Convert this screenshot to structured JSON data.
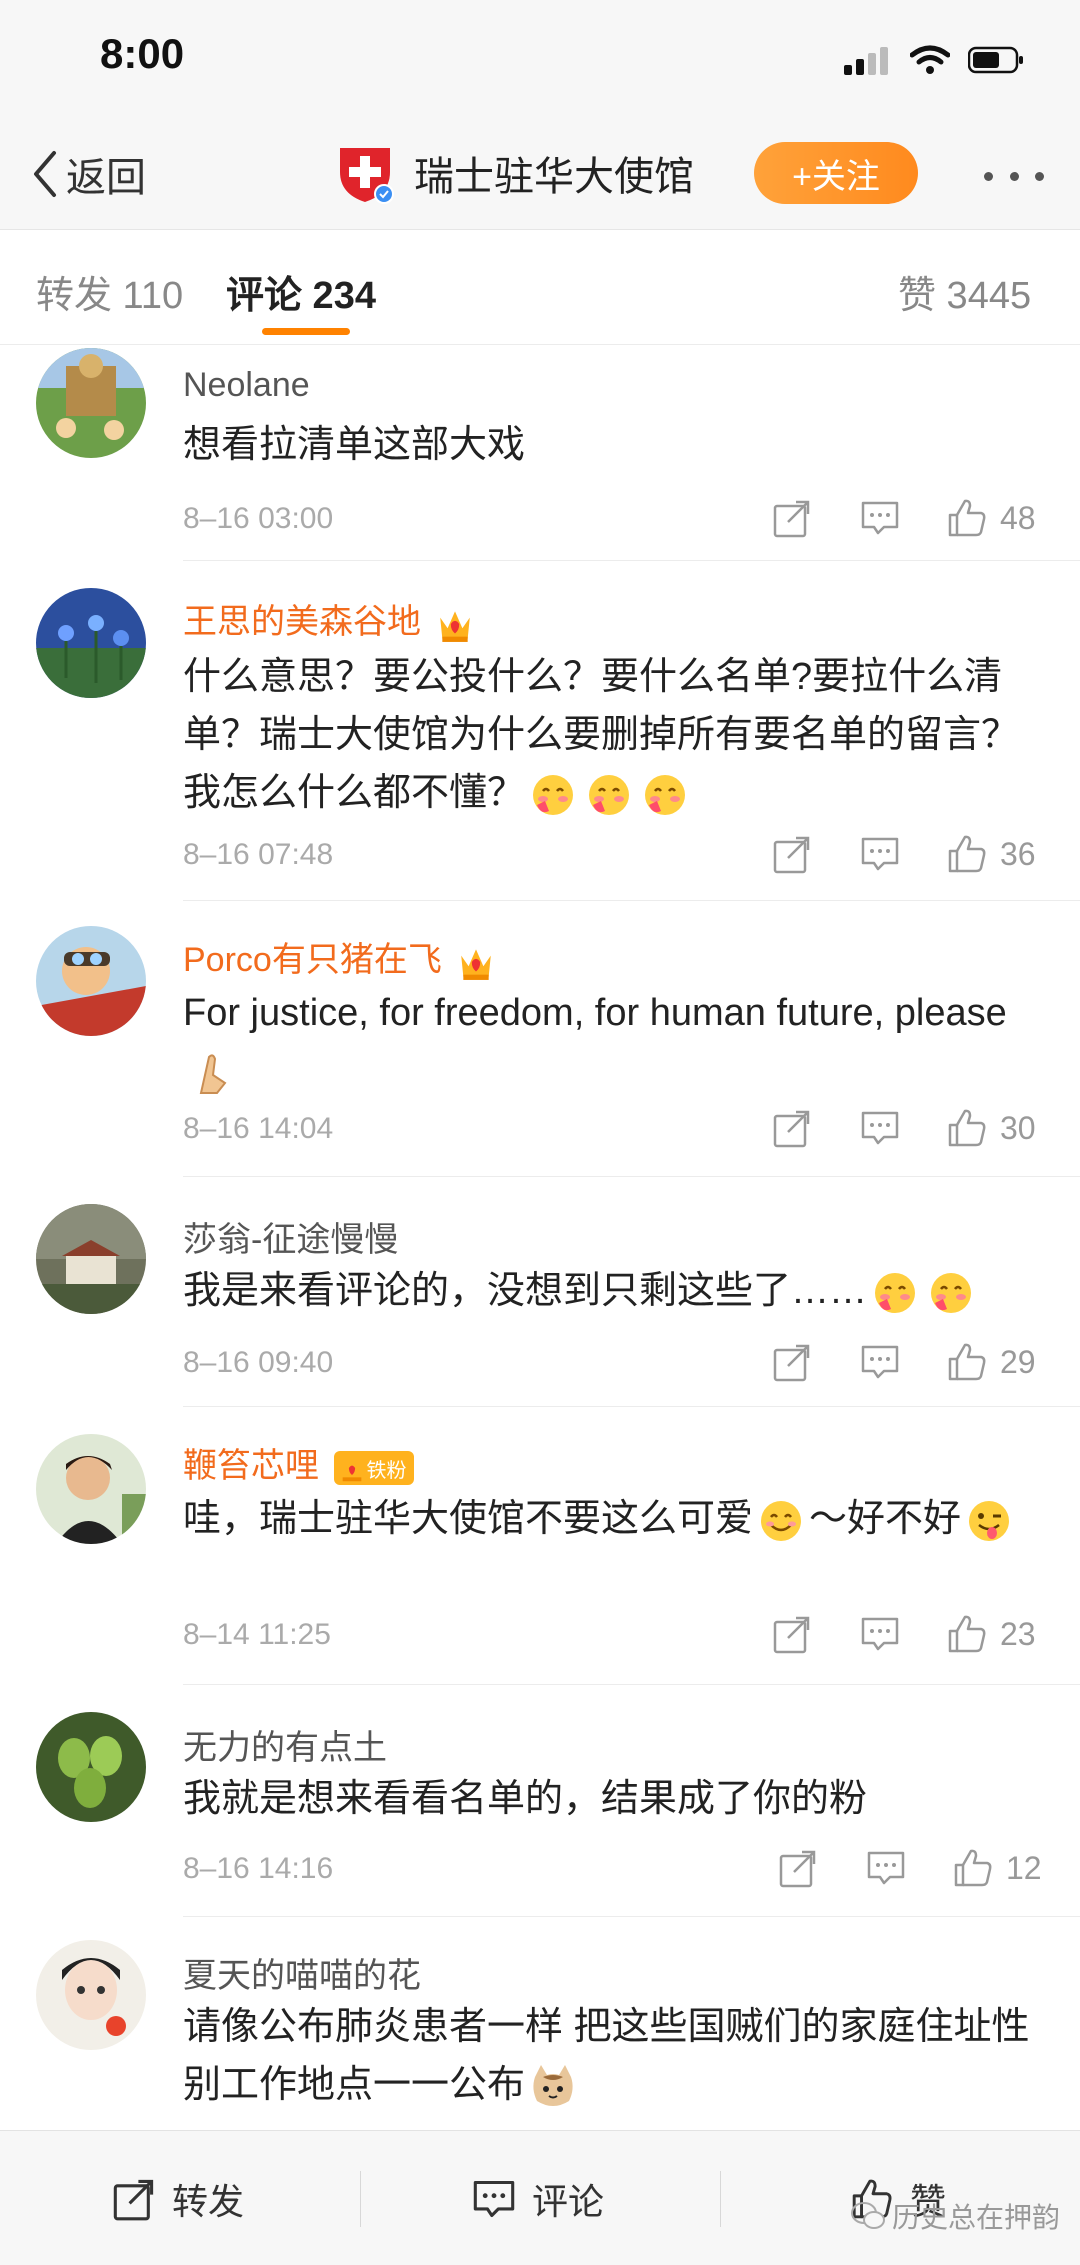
{
  "status_bar": {
    "time": "8:00"
  },
  "nav": {
    "back_label": "返回",
    "title": "瑞士驻华大使馆",
    "follow_label": "+关注"
  },
  "tabs": {
    "repost": "转发 110",
    "comments": "评论 234",
    "likes": "赞 3445"
  },
  "comments": [
    {
      "username": "Neolane",
      "text": "想看拉清单这部大戏",
      "time": "8–16 03:00",
      "likes": "48",
      "vip": false
    },
    {
      "username": "王思的美森谷地",
      "text": "什么意思？要公投什么？要什么名单?要拉什么清单？瑞士大使馆为什么要删掉所有要名单的留言？我怎么什么都不懂？",
      "time": "8–16 07:48",
      "likes": "36",
      "vip": true
    },
    {
      "username": "Porco有只猪在飞",
      "text": "For justice, for freedom, for human future, please",
      "time": "8–16 14:04",
      "likes": "30",
      "vip": true
    },
    {
      "username": "莎翁-征途慢慢",
      "text": "我是来看评论的，没想到只剩这些了……",
      "time": "8–16 09:40",
      "likes": "29",
      "vip": false
    },
    {
      "username": "鞭笞芯哩",
      "fan_badge": "铁粉",
      "text": "哇，瑞士驻华大使馆不要这么可爱",
      "text_tail": "～好不好",
      "time": "8–14 11:25",
      "likes": "23",
      "vip": true
    },
    {
      "username": "无力的有点土",
      "text": "我就是想来看看名单的，结果成了你的粉",
      "time": "8–16 14:16",
      "likes": "12",
      "vip": false
    },
    {
      "username": "夏天的喵喵的花",
      "text": "请像公布肺炎患者一样 把这些国贼们的家庭住址性别工作地点一一公布",
      "vip": false
    }
  ],
  "bottom_bar": {
    "repost": "转发",
    "comment": "评论",
    "like": "赞"
  },
  "watermark": "历史总在押韵",
  "colors": {
    "accent": "#ff8200",
    "vip_name": "#f26b1d",
    "swiss_red": "#e0242b"
  }
}
